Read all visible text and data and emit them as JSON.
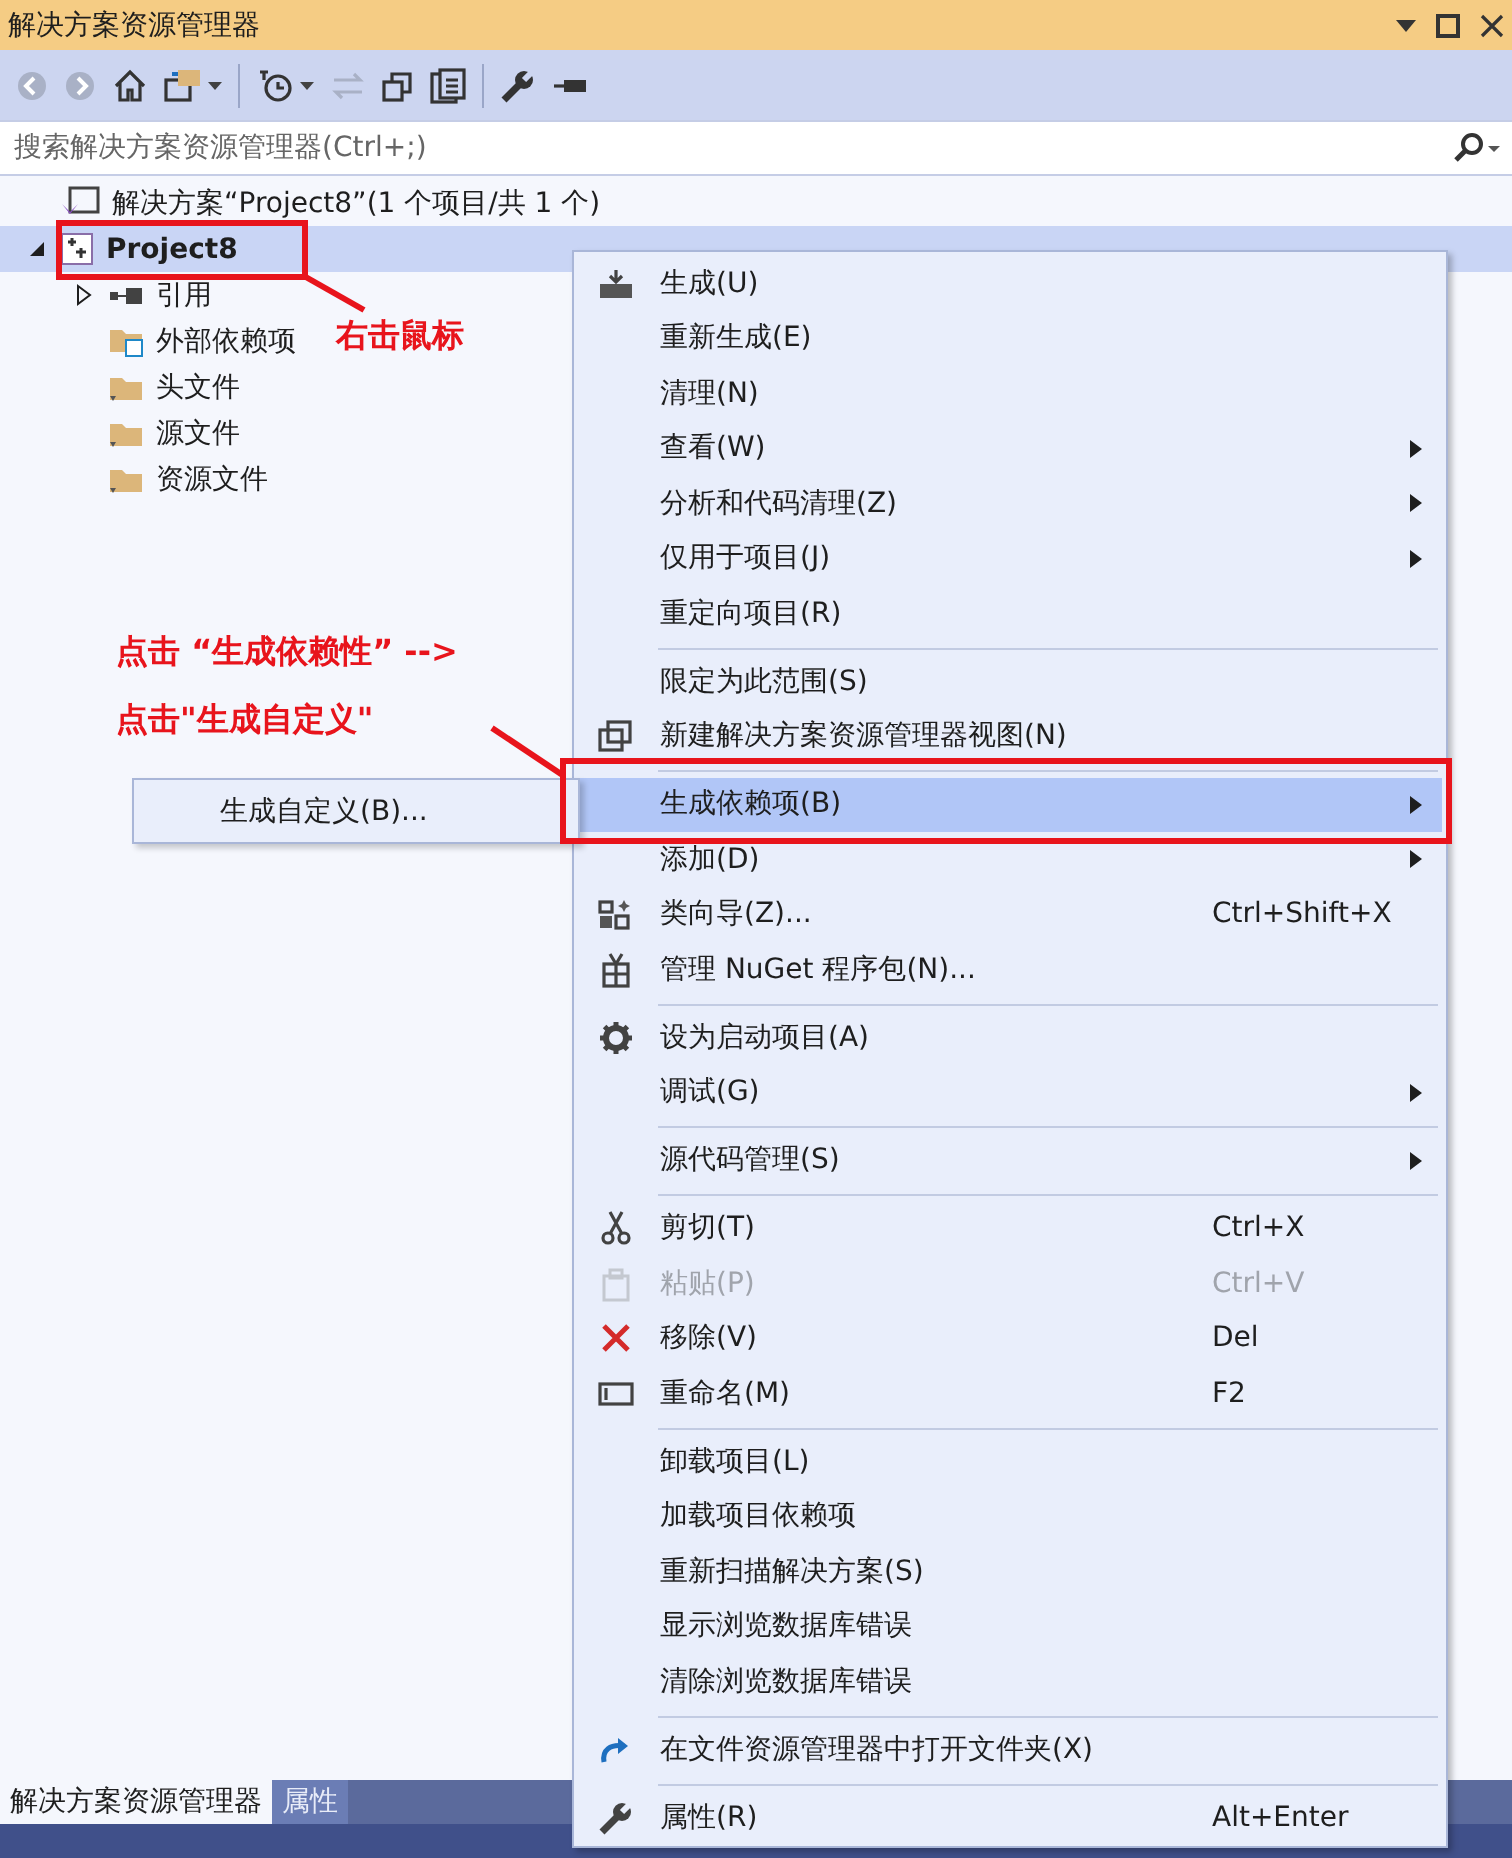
{
  "window": {
    "title": "解决方案资源管理器"
  },
  "search": {
    "placeholder": "搜索解决方案资源管理器(Ctrl+;)"
  },
  "tree": [
    {
      "label": "解决方案“Project8”(1 个项目/共 1 个)",
      "selected": false,
      "children": [
        {
          "label": "Project8",
          "selected": true,
          "expanded": true,
          "children": [
            {
              "label": "引用",
              "expanded": false,
              "selected": false,
              "kind": "references"
            },
            {
              "label": "外部依赖项",
              "selected": false,
              "kind": "external"
            },
            {
              "label": "头文件",
              "selected": false,
              "kind": "folder"
            },
            {
              "label": "源文件",
              "selected": false,
              "kind": "folder"
            },
            {
              "label": "资源文件",
              "selected": false,
              "kind": "folder"
            }
          ]
        }
      ]
    }
  ],
  "context_menu": [
    {
      "kind": "item",
      "label": "生成(U)"
    },
    {
      "kind": "item",
      "label": "重新生成(E)"
    },
    {
      "kind": "item",
      "label": "清理(N)"
    },
    {
      "kind": "item",
      "label": "查看(W)",
      "submenu": true
    },
    {
      "kind": "item",
      "label": "分析和代码清理(Z)",
      "submenu": true
    },
    {
      "kind": "item",
      "label": "仅用于项目(J)",
      "submenu": true
    },
    {
      "kind": "item",
      "label": "重定向项目(R)"
    },
    {
      "kind": "separator"
    },
    {
      "kind": "item",
      "label": "限定为此范围(S)"
    },
    {
      "kind": "item",
      "label": "新建解决方案资源管理器视图(N)"
    },
    {
      "kind": "separator"
    },
    {
      "kind": "item",
      "label": "生成依赖项(B)",
      "submenu": true,
      "selected": true
    },
    {
      "kind": "item",
      "label": "添加(D)",
      "submenu": true
    },
    {
      "kind": "item",
      "label": "类向导(Z)...",
      "shortcut": "Ctrl+Shift+X"
    },
    {
      "kind": "item",
      "label": "管理 NuGet 程序包(N)..."
    },
    {
      "kind": "separator"
    },
    {
      "kind": "item",
      "label": "设为启动项目(A)"
    },
    {
      "kind": "item",
      "label": "调试(G)",
      "submenu": true
    },
    {
      "kind": "separator"
    },
    {
      "kind": "item",
      "label": "源代码管理(S)",
      "submenu": true
    },
    {
      "kind": "separator"
    },
    {
      "kind": "item",
      "label": "剪切(T)",
      "shortcut": "Ctrl+X"
    },
    {
      "kind": "item",
      "label": "粘贴(P)",
      "shortcut": "Ctrl+V",
      "disabled": true
    },
    {
      "kind": "item",
      "label": "移除(V)",
      "shortcut": "Del"
    },
    {
      "kind": "item",
      "label": "重命名(M)",
      "shortcut": "F2"
    },
    {
      "kind": "separator"
    },
    {
      "kind": "item",
      "label": "卸载项目(L)"
    },
    {
      "kind": "item",
      "label": "加载项目依赖项"
    },
    {
      "kind": "item",
      "label": "重新扫描解决方案(S)"
    },
    {
      "kind": "item",
      "label": "显示浏览数据库错误"
    },
    {
      "kind": "item",
      "label": "清除浏览数据库错误"
    },
    {
      "kind": "separator"
    },
    {
      "kind": "item",
      "label": "在文件资源管理器中打开文件夹(X)"
    },
    {
      "kind": "separator"
    },
    {
      "kind": "item",
      "label": "属性(R)",
      "shortcut": "Alt+Enter"
    }
  ],
  "submenu": [
    {
      "label": "生成自定义(B)..."
    }
  ],
  "annotations": [
    "右击鼠标",
    "点击 “生成依赖性” -->",
    "点击\"生成自定义\""
  ],
  "bottom_tabs": [
    {
      "label": "解决方案资源管理器",
      "selected": true
    },
    {
      "label": "属性",
      "selected": false
    }
  ]
}
